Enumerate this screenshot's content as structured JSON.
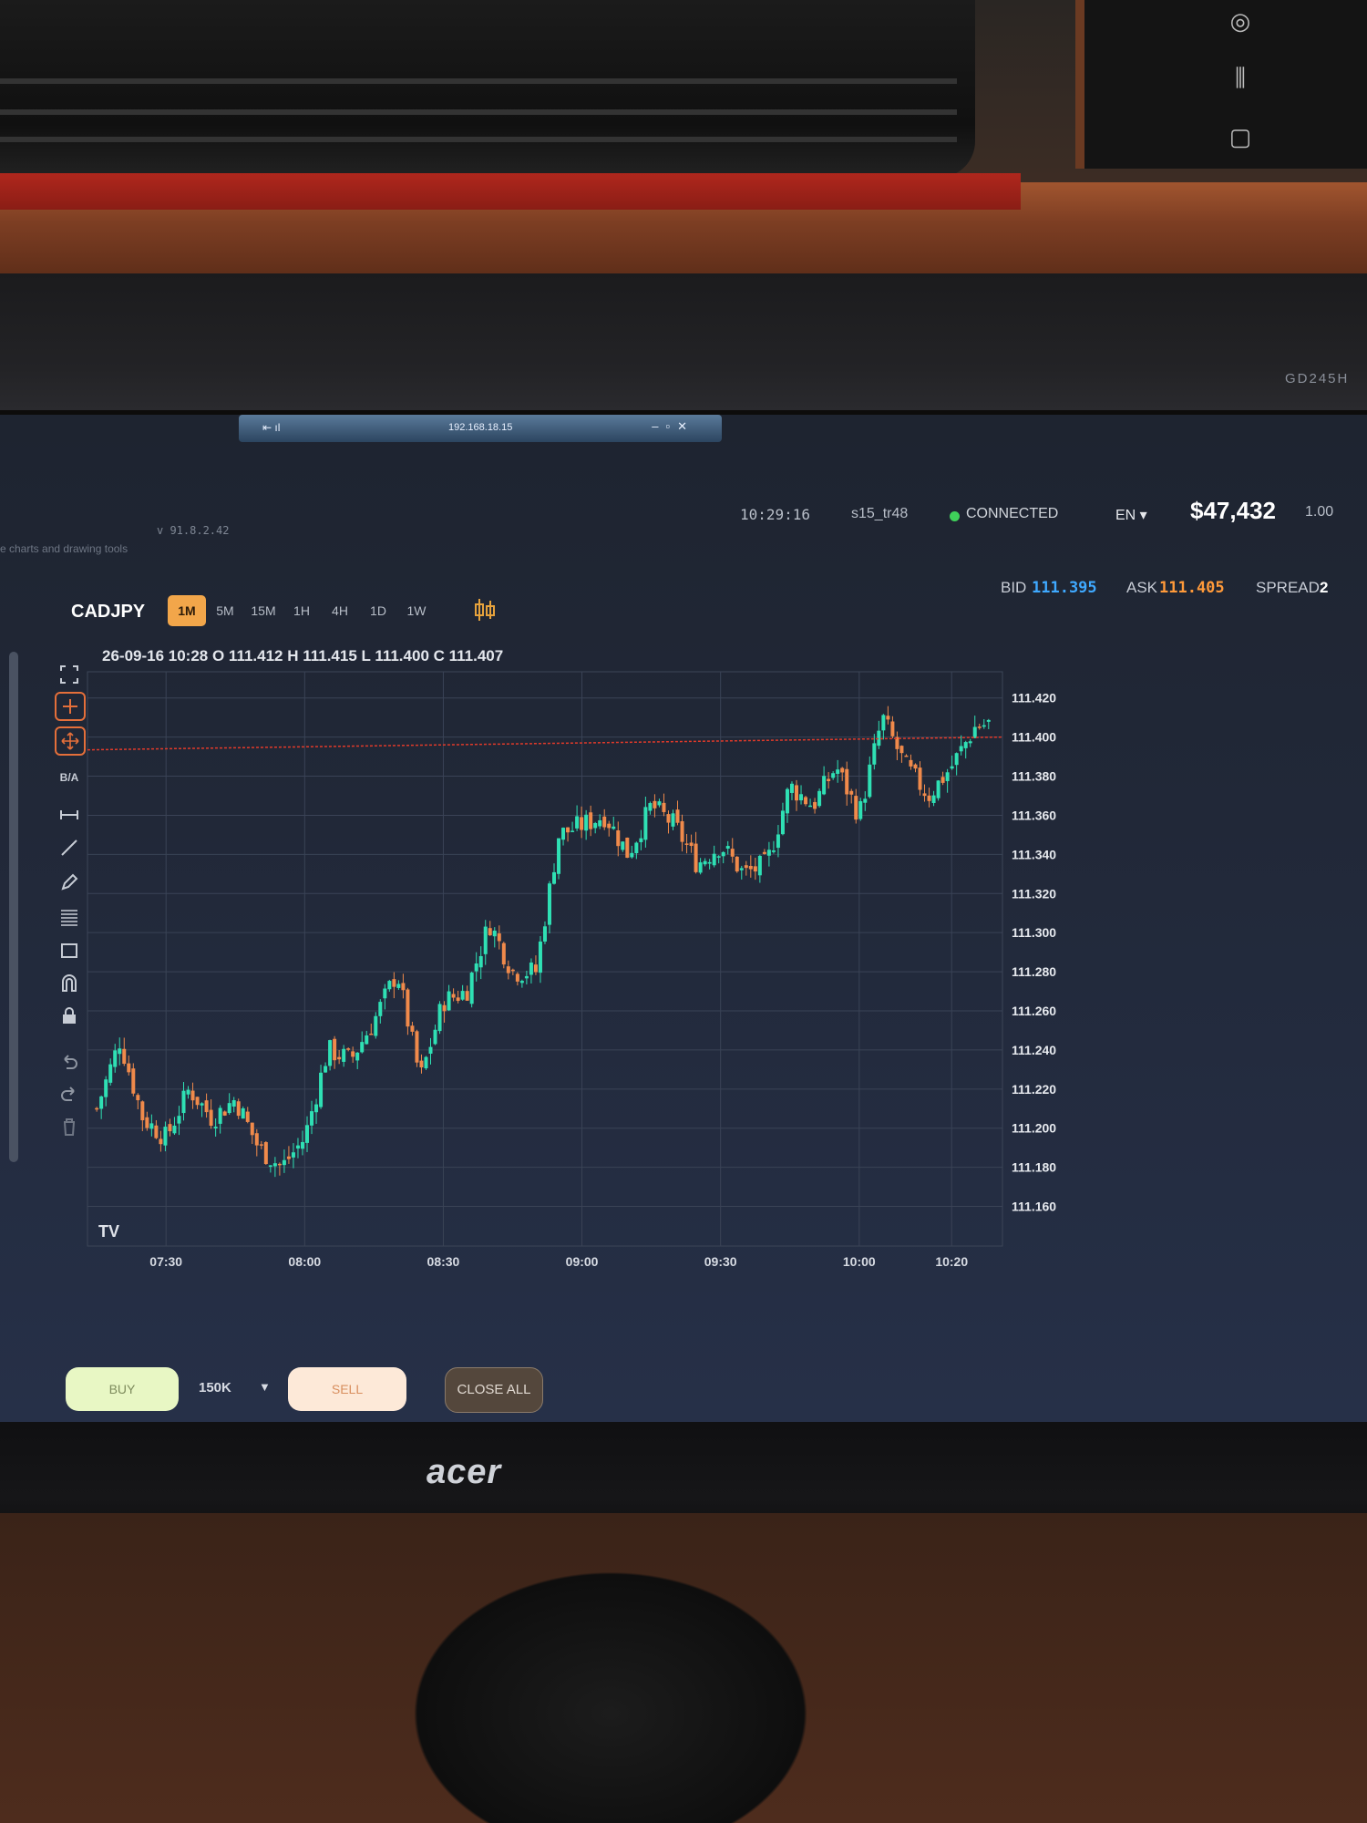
{
  "window": {
    "title": "192.168.18.15"
  },
  "header": {
    "version": "v 91.8.2.42",
    "tagline": "e charts and drawing tools",
    "clock": "10:29:16",
    "account": "s15_tr48",
    "status": "CONNECTED",
    "status_color": "#3fd05a",
    "language": "EN ▾",
    "balance": "$47,432",
    "multiplier": "1.00"
  },
  "quote": {
    "bid_label": "BID",
    "bid": "111.395",
    "ask_label": "ASK",
    "ask": "111.405",
    "spread_label": "SPREAD",
    "spread": "2"
  },
  "chart_header": {
    "symbol": "CADJPY",
    "timeframes": [
      "1M",
      "5M",
      "15M",
      "1H",
      "4H",
      "1D",
      "1W"
    ],
    "active_timeframe": "1M",
    "ohlc": "26-09-16 10:28 O 111.412 H 111.415 L 111.400 C 111.407"
  },
  "toolbar": {
    "ba_label": "B/A",
    "tools": [
      "fullscreen-icon",
      "crosshair-icon",
      "move-icon",
      "measure-icon",
      "trendline-icon",
      "pencil-icon",
      "fib-icon",
      "rectangle-icon",
      "magnet-icon",
      "lock-icon",
      "undo-icon",
      "redo-icon",
      "trash-icon"
    ]
  },
  "trade_bar": {
    "buy_label": "BUY",
    "quantity": "150K",
    "sell_label": "SELL",
    "close_all_label": "CLOSE ALL"
  },
  "colors": {
    "up": "#2fe0b4",
    "down": "#f08a4b",
    "bid_line": "#e03a2a",
    "accent": "#f2a64a"
  },
  "chart_data": {
    "type": "candlestick",
    "ylim": [
      111.15,
      111.425
    ],
    "yticks": [
      "111.420",
      "111.400",
      "111.380",
      "111.360",
      "111.340",
      "111.320",
      "111.300",
      "111.280",
      "111.260",
      "111.240",
      "111.220",
      "111.200",
      "111.180",
      "111.160"
    ],
    "xticks": [
      "07:30",
      "08:00",
      "08:30",
      "09:00",
      "09:30",
      "10:00",
      "10:20"
    ],
    "current_price": 111.4,
    "watermark": "TV",
    "close_path": [
      [
        "07:15",
        111.21
      ],
      [
        "07:20",
        111.245
      ],
      [
        "07:25",
        111.205
      ],
      [
        "07:30",
        111.195
      ],
      [
        "07:35",
        111.22
      ],
      [
        "07:40",
        111.205
      ],
      [
        "07:45",
        111.215
      ],
      [
        "07:50",
        111.19
      ],
      [
        "07:55",
        111.18
      ],
      [
        "08:00",
        111.195
      ],
      [
        "08:05",
        111.24
      ],
      [
        "08:10",
        111.235
      ],
      [
        "08:15",
        111.255
      ],
      [
        "08:20",
        111.28
      ],
      [
        "08:25",
        111.225
      ],
      [
        "08:30",
        111.265
      ],
      [
        "08:35",
        111.27
      ],
      [
        "08:40",
        111.305
      ],
      [
        "08:45",
        111.28
      ],
      [
        "08:50",
        111.28
      ],
      [
        "08:55",
        111.35
      ],
      [
        "09:00",
        111.355
      ],
      [
        "09:05",
        111.36
      ],
      [
        "09:10",
        111.34
      ],
      [
        "09:15",
        111.365
      ],
      [
        "09:20",
        111.355
      ],
      [
        "09:25",
        111.335
      ],
      [
        "09:30",
        111.345
      ],
      [
        "09:35",
        111.33
      ],
      [
        "09:40",
        111.335
      ],
      [
        "09:45",
        111.375
      ],
      [
        "09:50",
        111.365
      ],
      [
        "09:55",
        111.385
      ],
      [
        "10:00",
        111.36
      ],
      [
        "10:05",
        111.41
      ],
      [
        "10:10",
        111.385
      ],
      [
        "10:15",
        111.37
      ],
      [
        "10:20",
        111.385
      ],
      [
        "10:25",
        111.405
      ],
      [
        "10:28",
        111.407
      ]
    ]
  }
}
